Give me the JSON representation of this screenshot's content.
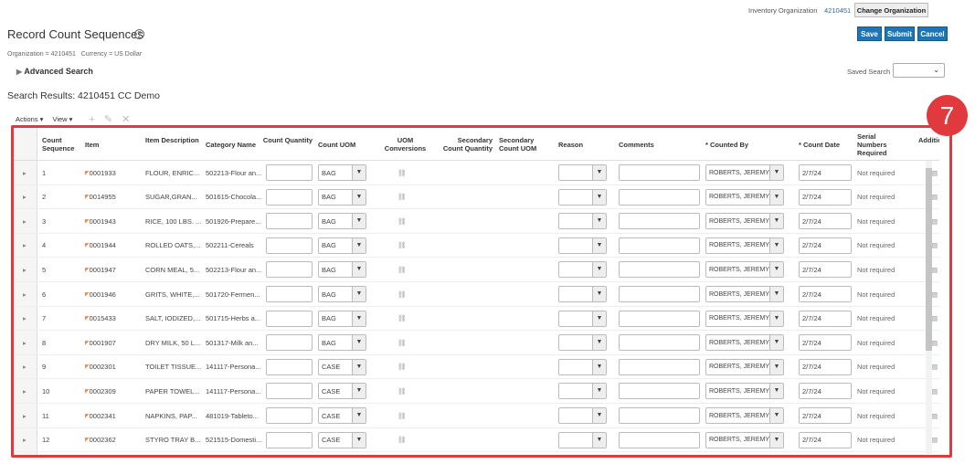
{
  "header": {
    "inventory_org_label": "Inventory Organization",
    "inventory_org_value": "4210451",
    "change_org": "Change Organization",
    "save": "Save",
    "submit": "Submit",
    "cancel": "Cancel"
  },
  "page": {
    "title": "Record Count Sequences",
    "filters": "Organization = 4210451   Currency = US Dollar",
    "advanced_search": "Advanced Search",
    "saved_search_label": "Saved Search",
    "saved_search_value": "",
    "results_title": "Search Results: 4210451 CC Demo"
  },
  "toolbar": {
    "actions": "Actions ▾",
    "view": "View ▾"
  },
  "badge": "7",
  "columns": [
    "Count Sequence",
    "Item",
    "Item Description",
    "Category Name",
    "Count Quantity",
    "Count UOM",
    "UOM Conversions",
    "Secondary Count Quantity",
    "Secondary Count UOM",
    "Reason",
    "Comments",
    "* Counted By",
    "* Count Date",
    "Serial Numbers Required",
    "Additional Information"
  ],
  "rows": [
    {
      "seq": "1",
      "item": "0001933",
      "desc": "FLOUR, ENRIC...",
      "cat": "502213-Flour an...",
      "uom": "BAG",
      "counted_by": "ROBERTS, JEREMY",
      "date": "2/7/24",
      "serial": "Not required"
    },
    {
      "seq": "2",
      "item": "0014955",
      "desc": "SUGAR,GRAN...",
      "cat": "501615-Chocola...",
      "uom": "BAG",
      "counted_by": "ROBERTS, JEREMY",
      "date": "2/7/24",
      "serial": "Not required"
    },
    {
      "seq": "3",
      "item": "0001943",
      "desc": "RICE, 100 LBS. ...",
      "cat": "501926-Prepare...",
      "uom": "BAG",
      "counted_by": "ROBERTS, JEREMY",
      "date": "2/7/24",
      "serial": "Not required"
    },
    {
      "seq": "4",
      "item": "0001944",
      "desc": "ROLLED OATS,...",
      "cat": "502211-Cereals",
      "uom": "BAG",
      "counted_by": "ROBERTS, JEREMY",
      "date": "2/7/24",
      "serial": "Not required"
    },
    {
      "seq": "5",
      "item": "0001947",
      "desc": "CORN MEAL, 5...",
      "cat": "502213-Flour an...",
      "uom": "BAG",
      "counted_by": "ROBERTS, JEREMY",
      "date": "2/7/24",
      "serial": "Not required"
    },
    {
      "seq": "6",
      "item": "0001946",
      "desc": "GRITS, WHITE,...",
      "cat": "501720-Fermen...",
      "uom": "BAG",
      "counted_by": "ROBERTS, JEREMY",
      "date": "2/7/24",
      "serial": "Not required"
    },
    {
      "seq": "7",
      "item": "0015433",
      "desc": "SALT, IODIZED,...",
      "cat": "501715-Herbs a...",
      "uom": "BAG",
      "counted_by": "ROBERTS, JEREMY",
      "date": "2/7/24",
      "serial": "Not required"
    },
    {
      "seq": "8",
      "item": "0001907",
      "desc": "DRY MILK, 50 L...",
      "cat": "501317-Milk an...",
      "uom": "BAG",
      "counted_by": "ROBERTS, JEREMY",
      "date": "2/7/24",
      "serial": "Not required"
    },
    {
      "seq": "9",
      "item": "0002301",
      "desc": "TOILET TISSUE...",
      "cat": "141117-Persona...",
      "uom": "CASE",
      "counted_by": "ROBERTS, JEREMY",
      "date": "2/7/24",
      "serial": "Not required"
    },
    {
      "seq": "10",
      "item": "0002309",
      "desc": "PAPER TOWEL...",
      "cat": "141117-Persona...",
      "uom": "CASE",
      "counted_by": "ROBERTS, JEREMY",
      "date": "2/7/24",
      "serial": "Not required"
    },
    {
      "seq": "11",
      "item": "0002341",
      "desc": "NAPKINS, PAP...",
      "cat": "481019-Tableto...",
      "uom": "CASE",
      "counted_by": "ROBERTS, JEREMY",
      "date": "2/7/24",
      "serial": "Not required"
    },
    {
      "seq": "12",
      "item": "0002362",
      "desc": "STYRO TRAY B...",
      "cat": "521515-Domesti...",
      "uom": "CASE",
      "counted_by": "ROBERTS, JEREMY",
      "date": "2/7/24",
      "serial": "Not required"
    }
  ]
}
